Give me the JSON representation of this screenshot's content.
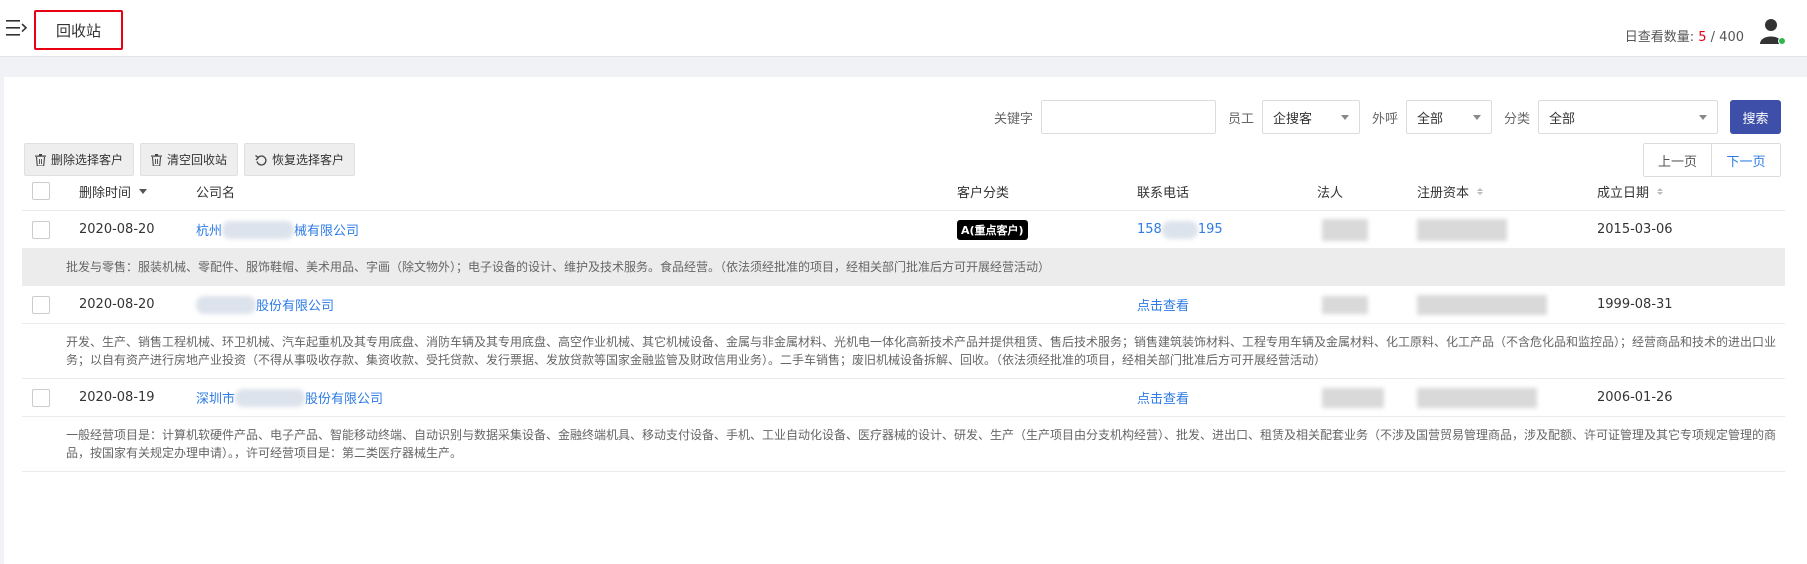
{
  "header": {
    "title": "回收站",
    "quota_label": "日查看数量:",
    "quota_current": "5",
    "quota_sep": "/",
    "quota_total": "400"
  },
  "filters": {
    "keyword_label": "关键字",
    "keyword_value": "",
    "employee_label": "员工",
    "employee_value": "企搜客",
    "outcall_label": "外呼",
    "outcall_value": "全部",
    "category_label": "分类",
    "category_value": "全部",
    "search_button": "搜索"
  },
  "toolbar": {
    "delete_selected": "删除选择客户",
    "clear_bin": "清空回收站",
    "restore_selected": "恢复选择客户"
  },
  "pager": {
    "prev": "上一页",
    "next": "下一页"
  },
  "columns": {
    "delete_time": "删除时间",
    "company": "公司名",
    "category": "客户分类",
    "phone": "联系电话",
    "legal": "法人",
    "capital": "注册资本",
    "founded": "成立日期"
  },
  "rows": [
    {
      "date": "2020-08-20",
      "company_prefix": "杭州",
      "company_suffix": "械有限公司",
      "category": "A(重点客户)",
      "phone_prefix": "158",
      "phone_suffix": "195",
      "founded": "2015-03-06",
      "desc": "批发与零售：服装机械、零配件、服饰鞋帽、美术用品、字画（除文物外）；电子设备的设计、维护及技术服务。食品经营。（依法须经批准的项目，经相关部门批准后方可开展经营活动）"
    },
    {
      "date": "2020-08-20",
      "company_prefix": "",
      "company_suffix": "股份有限公司",
      "category": "",
      "phone_link": "点击查看",
      "founded": "1999-08-31",
      "desc": "开发、生产、销售工程机械、环卫机械、汽车起重机及其专用底盘、消防车辆及其专用底盘、高空作业机械、其它机械设备、金属与非金属材料、光机电一体化高新技术产品并提供租赁、售后技术服务；销售建筑装饰材料、工程专用车辆及金属材料、化工原料、化工产品（不含危化品和监控品）；经营商品和技术的进出口业务；以自有资产进行房地产业投资（不得从事吸收存款、集资收款、受托贷款、发行票据、发放贷款等国家金融监管及财政信用业务）。二手车销售；废旧机械设备拆解、回收。（依法须经批准的项目，经相关部门批准后方可开展经营活动）"
    },
    {
      "date": "2020-08-19",
      "company_prefix": "深圳市",
      "company_suffix": "股份有限公司",
      "category": "",
      "phone_link": "点击查看",
      "founded": "2006-01-26",
      "desc": "一般经营项目是：计算机软硬件产品、电子产品、智能移动终端、自动识别与数据采集设备、金融终端机具、移动支付设备、手机、工业自动化设备、医疗器械的设计、研发、生产（生产项目由分支机构经营）、批发、进出口、租赁及相关配套业务（不涉及国营贸易管理商品，涉及配额、许可证管理及其它专项规定管理的商品，按国家有关规定办理申请）。，许可经营项目是：第二类医疗器械生产。"
    }
  ],
  "colors": {
    "accent": "#3d4fa8",
    "link": "#2d7be5",
    "highlight": "#e60012"
  }
}
